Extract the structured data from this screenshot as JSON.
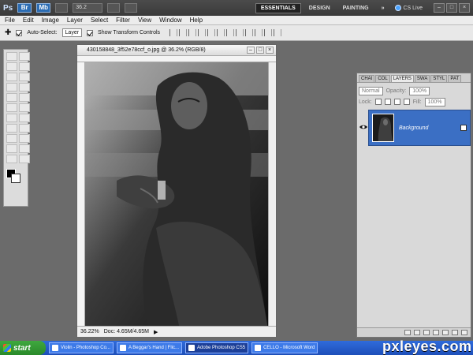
{
  "app": {
    "logo": "Ps",
    "zoom": "36.2",
    "workspace": {
      "essentials": "ESSENTIALS",
      "design": "DESIGN",
      "painting": "PAINTING",
      "more": "»"
    },
    "cslive": "CS Live"
  },
  "menu": [
    "File",
    "Edit",
    "Image",
    "Layer",
    "Select",
    "Filter",
    "View",
    "Window",
    "Help"
  ],
  "options": {
    "auto_select_label": "Auto-Select:",
    "auto_select_value": "Layer",
    "show_transform_label": "Show Transform Controls"
  },
  "document": {
    "title": "430158848_3f52e78ccf_o.jpg @ 36.2% (RGB/8)",
    "status_zoom": "36.22%",
    "status_doc": "Doc: 4.65M/4.65M"
  },
  "panels": {
    "tabs": [
      "CHAI",
      "COL",
      "LAYERS",
      "SWA",
      "STYL",
      "PAT"
    ],
    "active_tab": "LAYERS",
    "blend_mode": "Normal",
    "opacity_label": "Opacity:",
    "opacity_value": "100%",
    "lock_label": "Lock:",
    "fill_label": "Fill:",
    "fill_value": "100%",
    "layer_name": "Background"
  },
  "taskbar": {
    "start": "start",
    "tasks": [
      "Violin - Photoshop Co...",
      "A Beggar's Hand | Flic...",
      "Adobe Photoshop CS5",
      "CELLO - Microsoft Word"
    ],
    "active_task": "Adobe Photoshop CS5"
  },
  "watermark": "pxleyes.com",
  "colors": {
    "accent": "#3b6fc4",
    "taskbar": "#2f6bdb",
    "start": "#3fa83f"
  }
}
